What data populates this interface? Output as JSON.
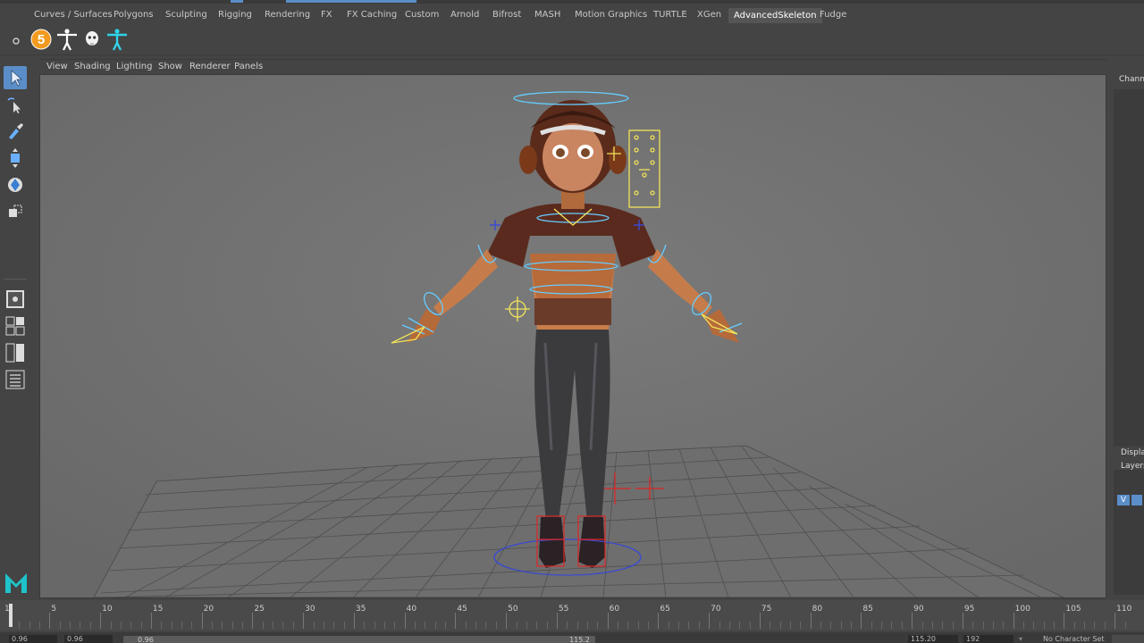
{
  "shelf_tabs": [
    "Curves / Surfaces",
    "Polygons",
    "Sculpting",
    "Rigging",
    "Rendering",
    "FX",
    "FX Caching",
    "Custom",
    "Arnold",
    "Bifrost",
    "MASH",
    "Motion Graphics",
    "TURTLE",
    "XGen",
    "AdvancedSkeleton",
    "Fudge"
  ],
  "active_shelf_tab": "AdvancedSkeleton",
  "shelf_badge": "5",
  "viewport_menu": [
    "View",
    "Shading",
    "Lighting",
    "Show",
    "Renderer",
    "Panels"
  ],
  "right_panel": {
    "channel_label": "Chann",
    "display_label": "Displa",
    "layers_label": "Layers",
    "layer_v": "V"
  },
  "timeline": {
    "labels": [
      "5",
      "10",
      "15",
      "20",
      "25",
      "30",
      "35",
      "40",
      "45",
      "50",
      "55",
      "60",
      "65",
      "70",
      "75",
      "80",
      "85",
      "90",
      "95",
      "100",
      "105",
      "110"
    ],
    "first": "1"
  },
  "range": {
    "start": "0.96",
    "current": "0.96",
    "slider_start": "0.96",
    "slider_end": "115.2",
    "end": "115.20",
    "playback_end": "192",
    "character_set": "No Character Set"
  },
  "colors": {
    "accent": "#5b8ec8",
    "viewport_bg": "#717171",
    "controller_blue": "#66ccff",
    "controller_yellow": "#f2e35a",
    "controller_red": "#e02424"
  }
}
